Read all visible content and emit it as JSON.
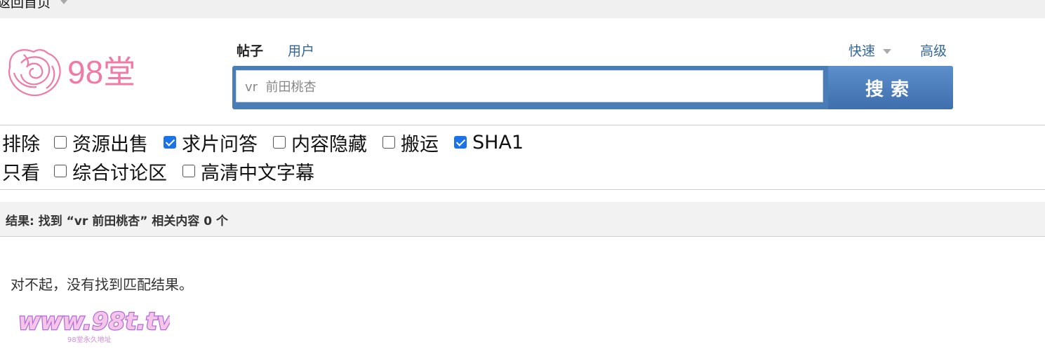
{
  "topbar": {
    "back_label": "返回首页"
  },
  "logo": {
    "text": "98堂"
  },
  "search": {
    "tabs": [
      "帖子",
      "用户"
    ],
    "quick_label": "快速",
    "advanced_label": "高级",
    "query": "vr  前田桃杏",
    "button_label": "搜索"
  },
  "filters": {
    "exclude": {
      "label": "排除",
      "options": [
        {
          "label": "资源出售",
          "checked": false
        },
        {
          "label": "求片问答",
          "checked": true
        },
        {
          "label": "内容隐藏",
          "checked": false
        },
        {
          "label": "搬运",
          "checked": false
        },
        {
          "label": "SHA1",
          "checked": true
        }
      ]
    },
    "only": {
      "label": "只看",
      "options": [
        {
          "label": "综合讨论区",
          "checked": false
        },
        {
          "label": "高清中文字幕",
          "checked": false
        }
      ]
    }
  },
  "results": {
    "summary": "结果: 找到 “vr 前田桃杏” 相关内容 0 个",
    "empty_message": "对不起，没有找到匹配结果。"
  },
  "watermark": {
    "url": "www.98t.tv",
    "subtitle": "98堂永久地址"
  },
  "colors": {
    "accent": "#4a7cb6",
    "link": "#336699",
    "logo_pink": "#f07aa6",
    "checkbox": "#1a73e8"
  }
}
